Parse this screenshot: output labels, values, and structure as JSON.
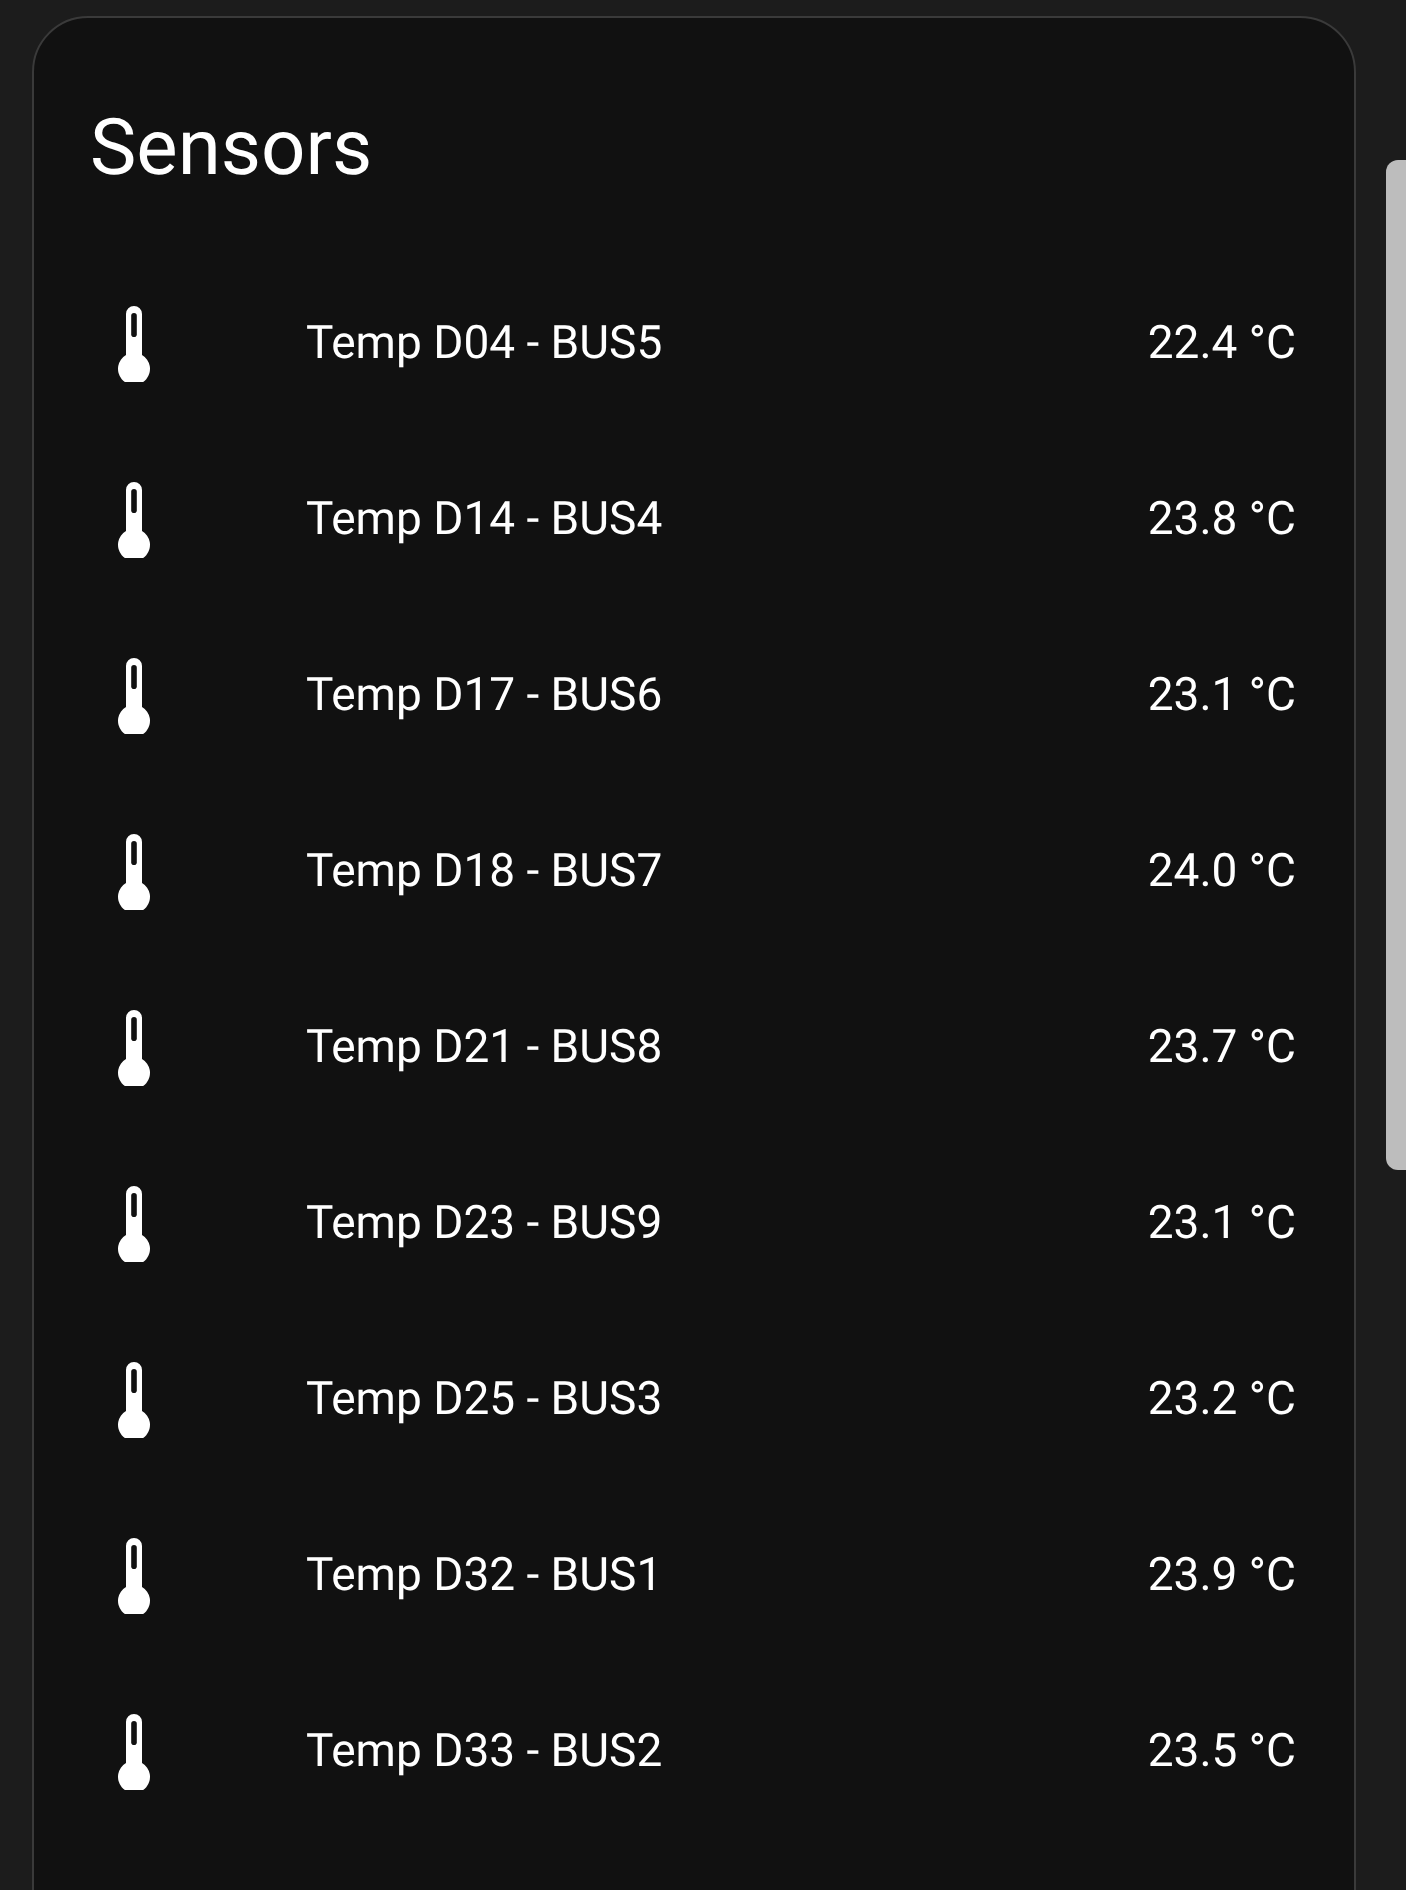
{
  "card": {
    "title": "Sensors",
    "sensors": [
      {
        "name": "Temp D04 - BUS5",
        "value": "22.4 °C"
      },
      {
        "name": "Temp D14 - BUS4",
        "value": "23.8 °C"
      },
      {
        "name": "Temp D17 - BUS6",
        "value": "23.1 °C"
      },
      {
        "name": "Temp D18 - BUS7",
        "value": "24.0 °C"
      },
      {
        "name": "Temp D21 - BUS8",
        "value": "23.7 °C"
      },
      {
        "name": "Temp D23 - BUS9",
        "value": "23.1 °C"
      },
      {
        "name": "Temp D25 - BUS3",
        "value": "23.2 °C"
      },
      {
        "name": "Temp D32 - BUS1",
        "value": "23.9 °C"
      },
      {
        "name": "Temp D33 - BUS2",
        "value": "23.5 °C"
      }
    ]
  }
}
